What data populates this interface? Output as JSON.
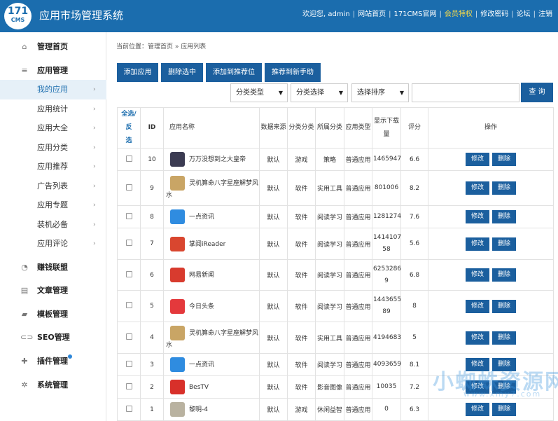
{
  "header": {
    "logo_num": "171",
    "logo_text": "CMS",
    "title": "应用市场管理系统",
    "welcome": "欢迎您, admin",
    "links": [
      "网站首页",
      "171CMS官网",
      "会员特权",
      "修改密码",
      "论坛",
      "注销"
    ]
  },
  "sidebar": {
    "items": [
      {
        "label": "管理首页",
        "type": "main",
        "icon": "home-icon"
      },
      {
        "label": "应用管理",
        "type": "main",
        "icon": "menu-icon"
      },
      {
        "label": "我的应用",
        "type": "sub",
        "active": true
      },
      {
        "label": "应用统计",
        "type": "sub"
      },
      {
        "label": "应用大全",
        "type": "sub"
      },
      {
        "label": "应用分类",
        "type": "sub"
      },
      {
        "label": "应用推荐",
        "type": "sub"
      },
      {
        "label": "广告列表",
        "type": "sub"
      },
      {
        "label": "应用专题",
        "type": "sub"
      },
      {
        "label": "装机必备",
        "type": "sub"
      },
      {
        "label": "应用评论",
        "type": "sub"
      },
      {
        "label": "赚钱联盟",
        "type": "main",
        "icon": "pie-chart-icon"
      },
      {
        "label": "文章管理",
        "type": "main",
        "icon": "article-icon"
      },
      {
        "label": "模板管理",
        "type": "main",
        "icon": "folder-icon"
      },
      {
        "label": "SEO管理",
        "type": "main",
        "icon": "link-icon"
      },
      {
        "label": "插件管理",
        "type": "main",
        "icon": "puzzle-icon"
      },
      {
        "label": "系统管理",
        "type": "main",
        "icon": "gear-icon"
      }
    ]
  },
  "breadcrumb": {
    "prefix": "当前位置：管理首页",
    "sep": "»",
    "current": "应用列表"
  },
  "toolbar": {
    "add": "添加应用",
    "delete": "删除选中",
    "recommend": "添加到推荐位",
    "novice": "推荐到新手助"
  },
  "filters": {
    "type": "分类类型",
    "category": "分类选择",
    "sort": "选择排序",
    "search_button": "查 询",
    "search_value": ""
  },
  "table": {
    "headers": {
      "select_all_a": "全选/反",
      "select_all_b": "选",
      "id": "ID",
      "name": "应用名称",
      "source": "数据来源",
      "category": "分类分类",
      "group": "所属分类",
      "apptype": "应用类型",
      "downloads_a": "显示下载",
      "downloads_b": "量",
      "score": "评分",
      "ops": "操作"
    },
    "edit_label": "修改",
    "delete_label": "删除",
    "rows": [
      {
        "id": "10",
        "name": "万万没想到之大皇帝",
        "source": "默认",
        "cat": "游戏",
        "group": "策略",
        "type": "普通应用",
        "dl": "1465947",
        "score": "6.6",
        "color": "#3b3b52"
      },
      {
        "id": "9",
        "name": "灵机算命八字星座解梦风水",
        "source": "默认",
        "cat": "软件",
        "group": "实用工具",
        "type": "普通应用",
        "dl": "801006",
        "score": "8.2",
        "color": "#c9a565"
      },
      {
        "id": "8",
        "name": "一点资讯",
        "source": "默认",
        "cat": "软件",
        "group": "阅读学习",
        "type": "普通应用",
        "dl": "1281274",
        "score": "7.6",
        "color": "#2f8ce0"
      },
      {
        "id": "7",
        "name": "掌阅iReader",
        "source": "默认",
        "cat": "软件",
        "group": "阅读学习",
        "type": "普通应用",
        "dl": "1414107\n58",
        "score": "5.6",
        "color": "#d9462f"
      },
      {
        "id": "6",
        "name": "网易新闻",
        "source": "默认",
        "cat": "软件",
        "group": "阅读学习",
        "type": "普通应用",
        "dl": "6253286\n9",
        "score": "6.8",
        "color": "#d83b2e"
      },
      {
        "id": "5",
        "name": "今日头条",
        "source": "默认",
        "cat": "软件",
        "group": "阅读学习",
        "type": "普通应用",
        "dl": "1443655\n89",
        "score": "8",
        "color": "#e4393c"
      },
      {
        "id": "4",
        "name": "灵机算命八字星座解梦风水",
        "source": "默认",
        "cat": "软件",
        "group": "实用工具",
        "type": "普通应用",
        "dl": "4194683",
        "score": "5",
        "color": "#c9a565"
      },
      {
        "id": "3",
        "name": "一点资讯",
        "source": "默认",
        "cat": "软件",
        "group": "阅读学习",
        "type": "普通应用",
        "dl": "4093659",
        "score": "8.1",
        "color": "#2f8ce0"
      },
      {
        "id": "2",
        "name": "BesTV",
        "source": "默认",
        "cat": "软件",
        "group": "影音图像",
        "type": "普通应用",
        "dl": "10035",
        "score": "7.2",
        "color": "#d8302a"
      },
      {
        "id": "1",
        "name": "黎明-4",
        "source": "默认",
        "cat": "游戏",
        "group": "休闲益智",
        "type": "普通应用",
        "dl": "0",
        "score": "6.3",
        "color": "#b9b2a0"
      }
    ]
  },
  "watermark": {
    "text": "小蜘蛛资源网",
    "url": "www.xmy7.com"
  }
}
